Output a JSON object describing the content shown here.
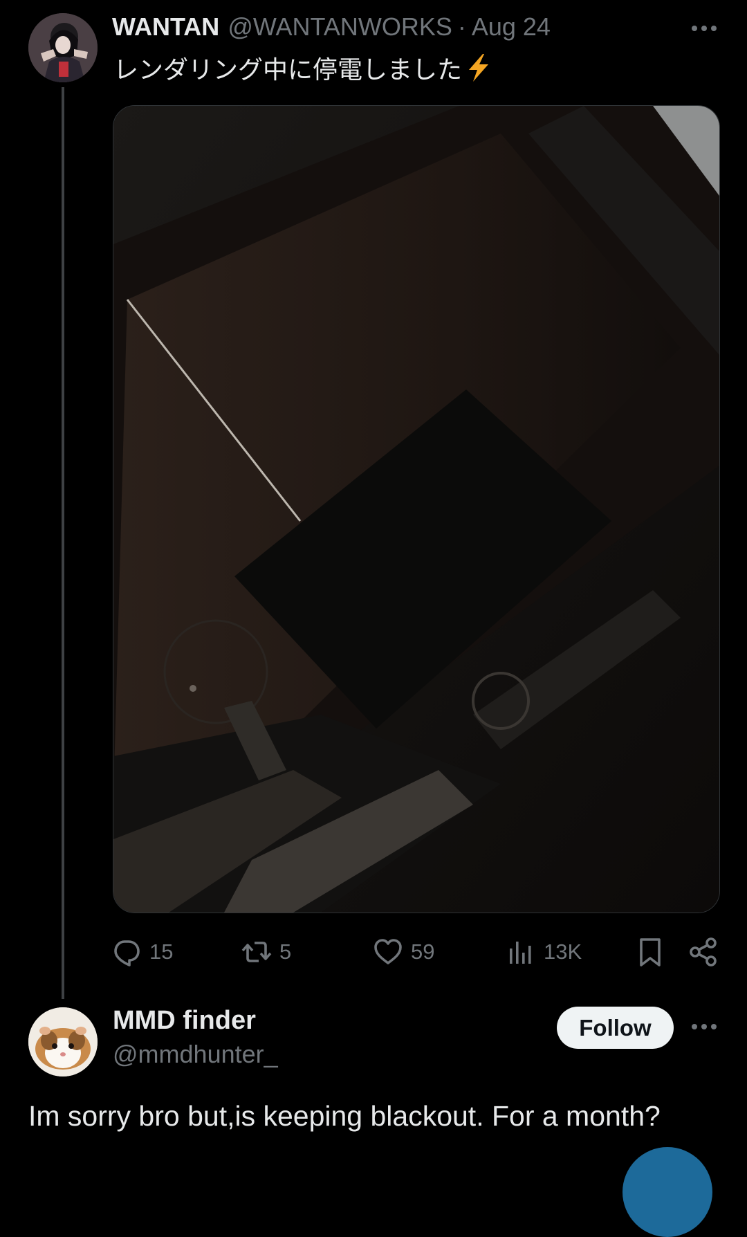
{
  "original_tweet": {
    "display_name": "WANTAN",
    "handle": "@WANTANWORKS",
    "separator": "·",
    "date": "Aug 24",
    "text": "レンダリング中に停電しました",
    "emoji_icon": "lightning-bolt-icon",
    "media_description_icon": "dark-room-photo",
    "actions": {
      "replies": "15",
      "reposts": "5",
      "likes": "59",
      "views": "13K"
    }
  },
  "reply_tweet": {
    "display_name": "MMD finder",
    "handle": "@mmdhunter_",
    "follow_label": "Follow",
    "text": "Im sorry bro but,is keeping blackout. For a month?"
  },
  "colors": {
    "background": "#000000",
    "primary_text": "#e7e9ea",
    "secondary_text": "#71767b",
    "follow_button_bg": "#eff3f4",
    "bolt": "#f5a623"
  }
}
